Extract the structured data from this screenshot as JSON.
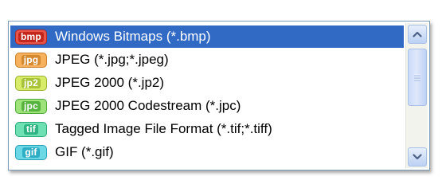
{
  "dropdown": {
    "items": [
      {
        "badge": "bmp",
        "label": "Windows Bitmaps (*.bmp)",
        "badge_bg": "#e8564a",
        "badge_border": "#b8281e",
        "badge_text_color": "#ffffff",
        "badge_text_bg": "#c2261c",
        "selected": true
      },
      {
        "badge": "jpg",
        "label": "JPEG (*.jpg;*.jpeg)",
        "badge_bg": "#f7b05c",
        "badge_border": "#c8802c",
        "badge_text_color": "#ffffff",
        "badge_text_bg": "#d4892f",
        "selected": false
      },
      {
        "badge": "jp2",
        "label": "JPEG 2000 (*.jp2)",
        "badge_bg": "#d8ec6a",
        "badge_border": "#98b030",
        "badge_text_color": "#ffffff",
        "badge_text_bg": "#a8c23a",
        "selected": false
      },
      {
        "badge": "jpc",
        "label": "JPEG 2000 Codestream (*.jpc)",
        "badge_bg": "#9ee27a",
        "badge_border": "#4ea83a",
        "badge_text_color": "#ffffff",
        "badge_text_bg": "#56b43f",
        "selected": false
      },
      {
        "badge": "tif",
        "label": "Tagged Image File Format (*.tif;*.tiff)",
        "badge_bg": "#6fe0b4",
        "badge_border": "#2aa878",
        "badge_text_color": "#ffffff",
        "badge_text_bg": "#2eb482",
        "selected": false
      },
      {
        "badge": "gif",
        "label": "GIF (*.gif)",
        "badge_bg": "#6cd8e6",
        "badge_border": "#2aa0b8",
        "badge_text_color": "#ffffff",
        "badge_text_bg": "#2eaec4",
        "selected": false
      }
    ],
    "selected_color": "#316ac5"
  },
  "scrollbar": {
    "up_icon": "chevron-up-icon",
    "down_icon": "chevron-down-icon",
    "arrow_color": "#4d6185"
  }
}
